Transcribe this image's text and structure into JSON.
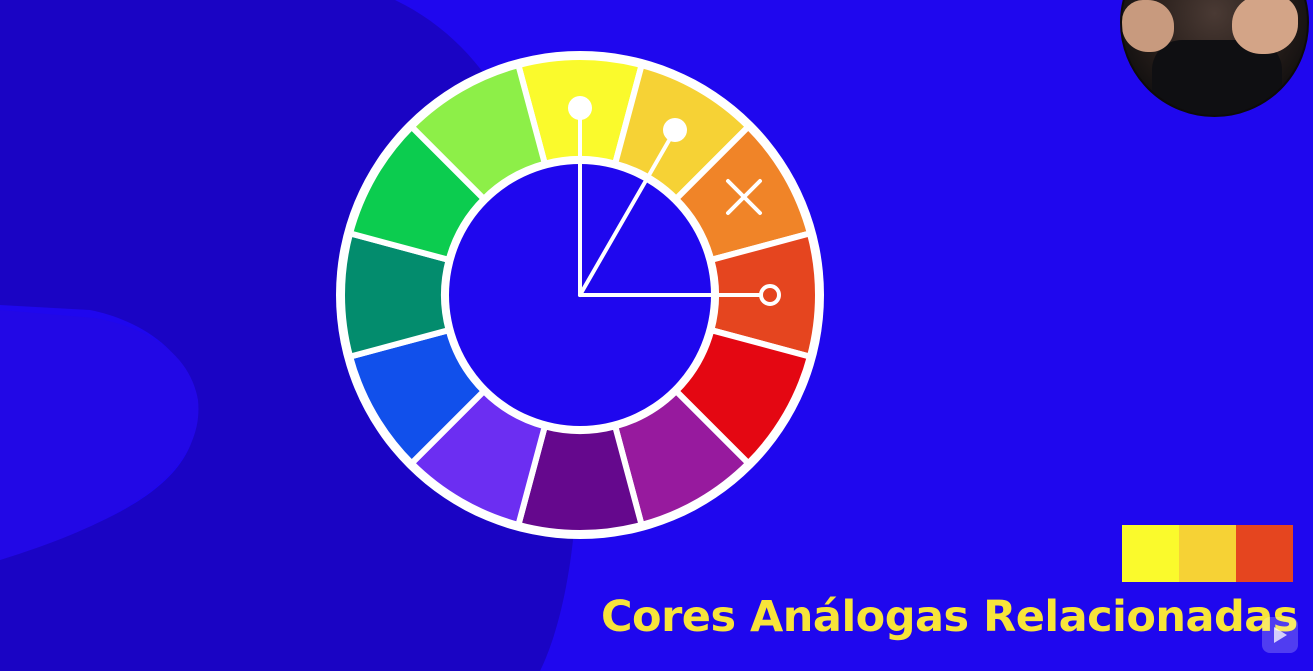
{
  "wheel": {
    "segment_colors": [
      "#fafa2c",
      "#f6d235",
      "#f08428",
      "#e5451f",
      "#e40712",
      "#971a9e",
      "#65088d",
      "#6c2ef2",
      "#1150eb",
      "#038c6d",
      "#0ccc4f",
      "#8def48"
    ],
    "analog_markers": {
      "dot_colors": [
        "#ffffff",
        "#ffffff"
      ],
      "ring_color": "#ffffff",
      "excluded": "x-mark"
    }
  },
  "palette": {
    "swatches": [
      "#fafa2c",
      "#f6d235",
      "#e5451f"
    ]
  },
  "caption": {
    "text": "Cores Análogas Relacionadas"
  },
  "icons": {
    "presenter": "webcam-overlay",
    "watermark": "play-icon"
  },
  "colors": {
    "background": "#1f07ee",
    "background_shape": "#1a04c4",
    "caption": "#f7e43a",
    "wheel_border": "#ffffff"
  }
}
